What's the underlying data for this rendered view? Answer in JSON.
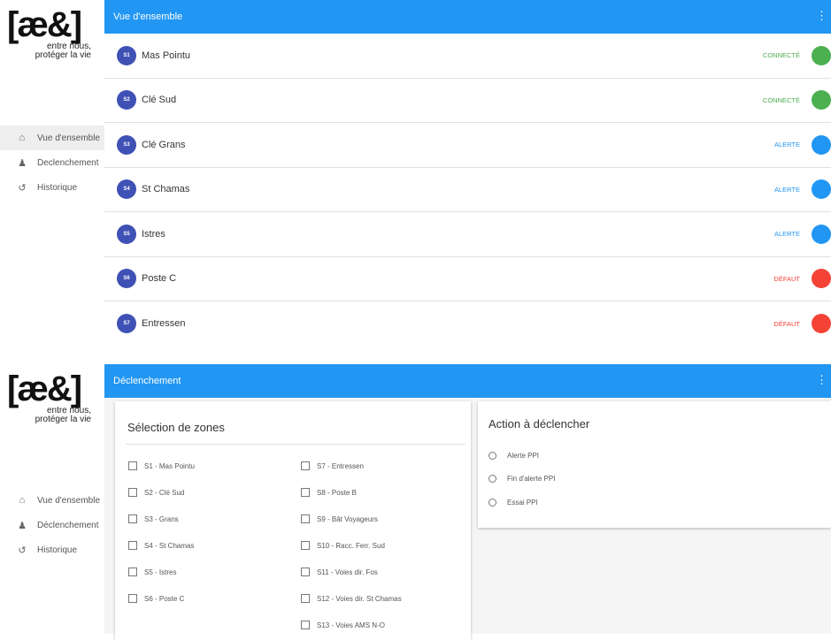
{
  "logo": {
    "brand": "[æ&]",
    "tagline_line1": "entre nous,",
    "tagline_line2": "protéger la vie"
  },
  "nav": [
    {
      "label": "Vue d'ensemble",
      "icon": "home-icon"
    },
    {
      "label": "Declenchement",
      "icon": "person-alert-icon"
    },
    {
      "label": "Historique",
      "icon": "history-icon"
    }
  ],
  "nav2": [
    {
      "label": "Vue d'ensemble",
      "icon": "home-icon"
    },
    {
      "label": "Déclenchement",
      "icon": "person-alert-icon"
    },
    {
      "label": "Historique",
      "icon": "history-icon"
    }
  ],
  "overview": {
    "title": "Vue d'ensemble",
    "stations": [
      {
        "badge": "S1",
        "name": "Mas Pointu",
        "status": "CONNECTÉ",
        "color": "#4caf50"
      },
      {
        "badge": "S2",
        "name": "Clé Sud",
        "status": "CONNECTÉ",
        "color": "#4caf50"
      },
      {
        "badge": "S3",
        "name": "Clé Grans",
        "status": "ALERTE",
        "color": "#2196f3"
      },
      {
        "badge": "S4",
        "name": "St Chamas",
        "status": "ALERTE",
        "color": "#2196f3"
      },
      {
        "badge": "S5",
        "name": "Istres",
        "status": "ALERTE",
        "color": "#2196f3"
      },
      {
        "badge": "S6",
        "name": "Poste C",
        "status": "DÉFAUT",
        "color": "#f44336"
      },
      {
        "badge": "S7",
        "name": "Entressen",
        "status": "DÉFAUT",
        "color": "#f44336"
      }
    ]
  },
  "trigger": {
    "title": "Déclenchement",
    "zones_title": "Sélection de zones",
    "zones_left": [
      "S1 - Mas Pointu",
      "S2 - Clé Sud",
      "S3 - Grans",
      "S4 - St Chamas",
      "S5 - Istres",
      "S6 - Poste C"
    ],
    "zones_right": [
      "S7 - Entressen",
      "S8 - Poste B",
      "S9 - Bât Voyageurs",
      "S10 - Racc. Ferr. Sud",
      "S11 - Voies dir. Fos",
      "S12 - Voies dir. St Chamas",
      "S13 - Voies AMS N-O"
    ],
    "action_title": "Action à déclencher",
    "actions": [
      "Alerte PPI",
      "Fin d'alerte PPI",
      "Essai PPI"
    ]
  },
  "colors": {
    "appbar": "#2196f3",
    "badge": "#3f51b5",
    "connected": "#4caf50",
    "alert": "#2196f3",
    "fault": "#f44336"
  }
}
